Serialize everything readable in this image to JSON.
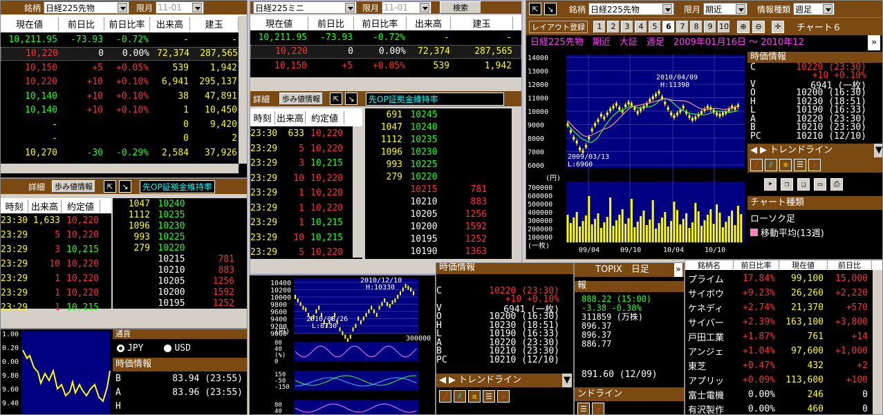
{
  "win1": {
    "brand_label": "銘柄",
    "brand_value": "日経225先物",
    "month_label": "限月",
    "month_value": "11-01",
    "cols": [
      "現在値",
      "前日比",
      "前日比率",
      "出来高",
      "建玉"
    ],
    "rows": [
      [
        "10,211.95",
        "-73.93",
        "-0.72%",
        "-",
        "-"
      ],
      [
        "10,220",
        "0",
        "0.00%",
        "72,374",
        "287,565"
      ],
      [
        "10,150",
        "+5",
        "+0.05%",
        "539",
        "1,942"
      ],
      [
        "10,220",
        "+10",
        "+0.10%",
        "6,941",
        "295,137"
      ],
      [
        "10,140",
        "+10",
        "+0.10%",
        "38",
        "47,891"
      ],
      [
        "10,140",
        "+10",
        "+0.10%",
        "1",
        "10,450"
      ],
      [
        "-",
        "",
        "",
        "0",
        "9,420"
      ],
      [
        "-",
        "",
        "",
        "0",
        "2"
      ],
      [
        "10,270",
        "-30",
        "-0.29%",
        "2,584",
        "37,926"
      ]
    ]
  },
  "detail": {
    "label": "詳細",
    "btn": "歩み値情報",
    "banner": "先OP証拠金維持率",
    "cols": [
      "時刻",
      "出来高",
      "約定値"
    ],
    "ticks": [
      [
        "23:30",
        "1,633",
        "10,220"
      ],
      [
        "23:29",
        "5",
        "10,220"
      ],
      [
        "23:29",
        "3",
        "10,215"
      ],
      [
        "23:29",
        "10",
        "10,220"
      ],
      [
        "23:29",
        "1",
        "10,220"
      ],
      [
        "23:29",
        "1",
        "10,220"
      ],
      [
        "23:29",
        "1",
        "10,215"
      ]
    ],
    "book": [
      [
        "1047",
        "10240",
        ""
      ],
      [
        "1112",
        "10235",
        ""
      ],
      [
        "1096",
        "10230",
        ""
      ],
      [
        "993",
        "10225",
        ""
      ],
      [
        "279",
        "10220",
        ""
      ],
      [
        "",
        "10215",
        "781"
      ],
      [
        "",
        "10210",
        "883"
      ],
      [
        "",
        "10205",
        "1256"
      ],
      [
        "",
        "10200",
        "1592"
      ],
      [
        "",
        "10195",
        "1252"
      ]
    ]
  },
  "win2": {
    "brand_value": "日経225ミニ",
    "month_label": "限月",
    "month_value": "11-01",
    "search_btn": "検索",
    "cols": [
      "現在値",
      "前日比",
      "前日比率",
      "出来高",
      "建玉"
    ],
    "rows": [
      [
        "10,211.95",
        "-73.93",
        "-0.72%",
        "-",
        "-"
      ],
      [
        "10,220",
        "0",
        "0.00%",
        "72,374",
        "287,565"
      ],
      [
        "10,150",
        "+5",
        "+0.05%",
        "539",
        "1,942"
      ]
    ],
    "ticks": [
      [
        "23:30",
        "633",
        "10,220"
      ],
      [
        "23:29",
        "5",
        "10,220"
      ],
      [
        "23:29",
        "3",
        "10,215"
      ],
      [
        "23:29",
        "10",
        "10,220"
      ],
      [
        "23:29",
        "1",
        "10,220"
      ],
      [
        "23:29",
        "1",
        "10,220"
      ],
      [
        "23:29",
        "1",
        "10,215"
      ],
      [
        "23:29",
        "10",
        "10,215"
      ],
      [
        "23:29",
        "5",
        "10,220"
      ]
    ],
    "book": [
      [
        "691",
        "10245",
        ""
      ],
      [
        "1047",
        "10240",
        ""
      ],
      [
        "1112",
        "10235",
        ""
      ],
      [
        "1096",
        "10230",
        ""
      ],
      [
        "993",
        "10225",
        ""
      ],
      [
        "279",
        "10220",
        ""
      ],
      [
        "",
        "10215",
        "781"
      ],
      [
        "",
        "10210",
        "883"
      ],
      [
        "",
        "10205",
        "1256"
      ],
      [
        "",
        "10200",
        "1592"
      ],
      [
        "",
        "10195",
        "1252"
      ],
      [
        "",
        "10190",
        "1363"
      ]
    ]
  },
  "chart6": {
    "brand_label": "銘柄",
    "brand_value": "日経225先物",
    "month_label": "限月",
    "month_value": "期近",
    "info_label": "情報種類",
    "info_value": "週足",
    "layout_btn": "レイアウト登録",
    "tabs": [
      "1",
      "2",
      "3",
      "4",
      "5",
      "6",
      "7",
      "8",
      "9",
      "10"
    ],
    "active_tab": "6",
    "chart_title": "チャート６",
    "subtitle": "日経225先物　期近　大証　週足　2009年01月16日 ～ 2010年12",
    "y_ticks": [
      "14000",
      "13000",
      "12000",
      "11000",
      "10000",
      "9000",
      "8000",
      "7000",
      "6000"
    ],
    "vol_ticks": [
      "700000",
      "600000",
      "500000",
      "400000",
      "300000",
      "200000",
      "100000",
      "(一枚)"
    ],
    "yen_label": "(円)",
    "x_ticks": [
      "09/04",
      "09/10",
      "10/04",
      "10/10"
    ],
    "high_annot": "2010/04/09",
    "high_val": "H:11390",
    "low_annot": "2009/03/13",
    "low_val": "L:6960",
    "time_info_title": "時価情報",
    "time_info": [
      [
        "C",
        "10220 (23:30)"
      ],
      [
        "",
        "+10 +0.10%"
      ],
      [
        "V",
        "6941 (一枚)"
      ],
      [
        "O",
        "10200 (16:30)"
      ],
      [
        "H",
        "10230 (18:51)"
      ],
      [
        "L",
        "10190 (16:33)"
      ],
      [
        "A",
        "10220 (23:30)"
      ],
      [
        "B",
        "10210 (23:30)"
      ],
      [
        "PC",
        "10210 (12/10)"
      ]
    ],
    "trend_title": "トレンドライン",
    "chart_type_title": "チャート種類",
    "chart_type": "ローソク足",
    "ma_label": "移動平均(13週)"
  },
  "chart_mid": {
    "y_ticks": [
      "10400",
      "10200",
      "10000",
      "9800",
      "9600",
      "9400",
      "9200",
      "9000"
    ],
    "annot_high": "2010/12/10",
    "annot_high_val": "H:10330",
    "annot_low": "2010/08/26",
    "annot_low_val": "L:8730",
    "vol_label": "300000",
    "yen": "(円)",
    "osc1": [
      "80",
      "40",
      "(%)",
      "0"
    ],
    "osc2": [
      "150",
      "-50",
      "-150"
    ],
    "osc3": [
      "80",
      "40"
    ]
  },
  "mid_info": {
    "title": "時価情報",
    "rows": [
      [
        "C",
        "10220 (23:30)"
      ],
      [
        "",
        "+10 +0.10%"
      ],
      [
        "V",
        "6941 (一枚)"
      ],
      [
        "O",
        "10200 (16:30)"
      ],
      [
        "H",
        "10230 (18:51)"
      ],
      [
        "L",
        "10190 (16:33)"
      ],
      [
        "A",
        "10220 (23:30)"
      ],
      [
        "B",
        "10210 (23:30)"
      ],
      [
        "PC",
        "10210 (12/10)"
      ]
    ],
    "trend_title": "トレンドライン"
  },
  "topix": {
    "title": "TOPIX　日足",
    "info": "報",
    "rows": [
      "888.22 (15:00)",
      "-3.38 -0.38%",
      "311859 (万株)",
      "896.37",
      "896.37",
      "886.77"
    ],
    "last": "891.60 (12/09)",
    "trend_title": "ンドライン"
  },
  "ranking": {
    "header": [
      "銘柄名",
      "前日比率",
      "現在値",
      "前日比"
    ],
    "rows": [
      [
        "プライム",
        "17.84%",
        "99,100",
        "15,000"
      ],
      [
        "サイボウ",
        "+9.23%",
        "26,260",
        "+2,220"
      ],
      [
        "ケネディ",
        "+2.74%",
        "21,370",
        "+570"
      ],
      [
        "サイバー",
        "+2.39%",
        "163,100",
        "+3,800"
      ],
      [
        "戸田工業",
        "+1.87%",
        "761",
        "+14"
      ],
      [
        "アンジェ",
        "+1.04%",
        "97,600",
        "+1,000"
      ],
      [
        "東芝",
        "+0.47%",
        "432",
        "+2"
      ],
      [
        "アプリッ",
        "+0.09%",
        "113,600",
        "+100"
      ],
      [
        "富士電機",
        "0.00%",
        "246",
        "0"
      ],
      [
        "有沢製作",
        "0.00%",
        "460",
        "0"
      ]
    ]
  },
  "fx": {
    "section": "通貨",
    "opt_jpy": "JPY",
    "opt_usd": "USD",
    "title": "時価情報",
    "rows": [
      [
        "B",
        "83.94 (23:55)"
      ],
      [
        "A",
        "83.96 (23:55)"
      ],
      [
        "H",
        ""
      ]
    ],
    "y_ticks": [
      "1.00",
      "0.20",
      "0.00",
      "9.80",
      "9.60",
      "9.40"
    ]
  },
  "colors": {
    "brown": "#7a4a12",
    "up": "#ff3030",
    "green": "#22ff22",
    "yellow": "#ffff00",
    "chartbg": "#000080"
  }
}
